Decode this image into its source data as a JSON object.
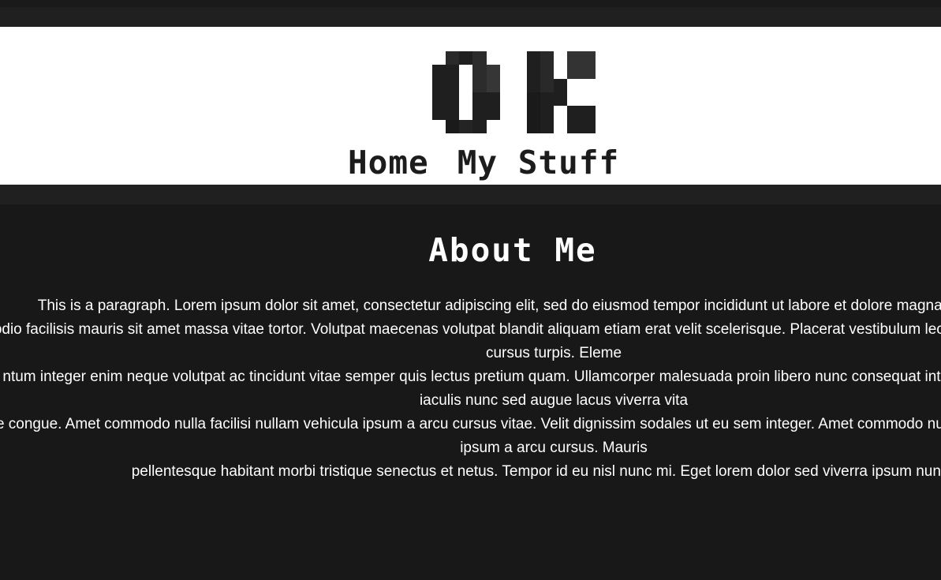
{
  "header": {
    "logo_text": "OK",
    "nav": [
      {
        "label": "Home"
      },
      {
        "label": "My Stuff"
      }
    ]
  },
  "main": {
    "title": "About Me",
    "paragraph": "This is a paragraph. Lorem ipsum dolor sit amet, consectetur adipiscing elit, sed do eiusmod tempor incididunt ut labore et dolore magna aliqua. Eu volutpat\nodio facilisis mauris sit amet massa vitae tortor. Volutpat maecenas volutpat blandit aliquam etiam erat velit scelerisque. Placerat vestibulum lectus mauris ultrices eros in cursus turpis. Eleme\nntum integer enim neque volutpat ac tincidunt vitae semper quis lectus pretium quam. Ullamcorper malesuada proin libero nunc consequat interdum varius sit amet. In iaculis nunc sed augue lacus viverra vita\ne congue. Amet commodo nulla facilisi nullam vehicula ipsum a arcu cursus vitae. Velit dignissim sodales ut eu sem integer. Amet commodo nulla facilisi nullam vehicula ipsum a arcu cursus. Mauris\npellentesque habitant morbi tristique senectus et netus. Tempor id eu nisl nunc mi. Eget lorem dolor sed viverra ipsum nunc aliq"
  },
  "colors": {
    "page_bg": "#181818",
    "band_bg": "#202020",
    "header_bg": "#ffffff",
    "text_dark": "#1c1c1c",
    "text_light": "#ffffff"
  }
}
